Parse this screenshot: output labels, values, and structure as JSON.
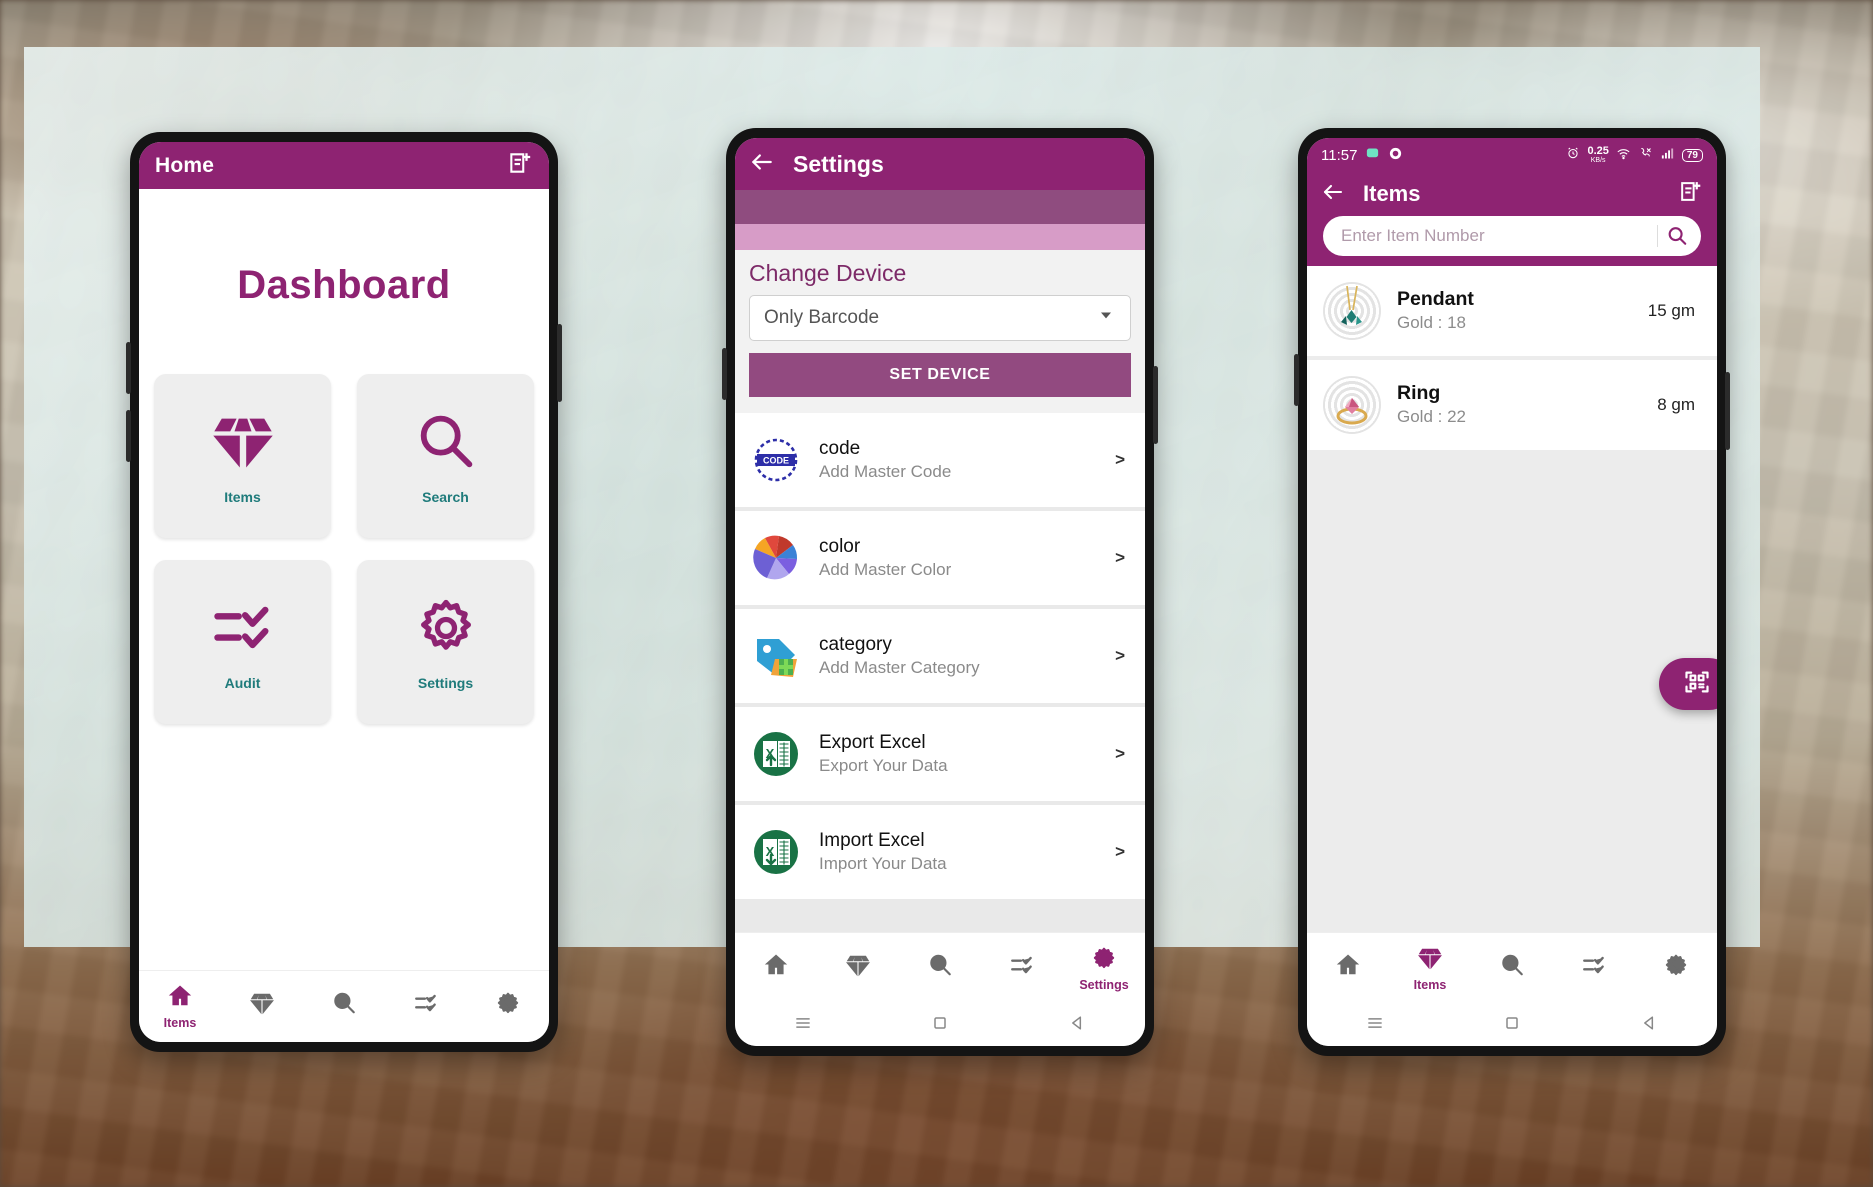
{
  "theme": {
    "brand_purple": "#8E2372",
    "tile_label_teal": "#1f7b7b",
    "muted_purple": "#8f4c7f",
    "light_pink": "#d79cc7"
  },
  "phone1": {
    "appbar": {
      "title": "Home",
      "action_icon": "note-add-icon"
    },
    "dashboard_title": "Dashboard",
    "tiles": [
      {
        "label": "Items",
        "icon": "diamond-icon"
      },
      {
        "label": "Search",
        "icon": "search-icon"
      },
      {
        "label": "Audit",
        "icon": "checklist-icon"
      },
      {
        "label": "Settings",
        "icon": "gear-icon"
      }
    ],
    "bottom_nav": [
      {
        "label": "Items",
        "icon": "home-icon",
        "active": true
      },
      {
        "label": "",
        "icon": "diamond-icon",
        "active": false
      },
      {
        "label": "",
        "icon": "search-icon",
        "active": false
      },
      {
        "label": "",
        "icon": "checklist-icon",
        "active": false
      },
      {
        "label": "",
        "icon": "gear-icon",
        "active": false
      }
    ]
  },
  "phone2": {
    "appbar": {
      "back_icon": "back-arrow-icon",
      "title": "Settings"
    },
    "section": {
      "title": "Change Device",
      "select_value": "Only Barcode",
      "select_icon": "chevron-down-icon",
      "button_label": "SET DEVICE"
    },
    "rows": [
      {
        "title": "code",
        "subtitle": "Add Master Code",
        "icon": "code-stamp-icon",
        "chevron": ">"
      },
      {
        "title": "color",
        "subtitle": "Add Master Color",
        "icon": "color-fan-icon",
        "chevron": ">"
      },
      {
        "title": "category",
        "subtitle": "Add Master Category",
        "icon": "category-tag-icon",
        "chevron": ">"
      },
      {
        "title": "Export Excel",
        "subtitle": "Export Your Data",
        "icon": "excel-export-icon",
        "chevron": ">"
      },
      {
        "title": "Import Excel",
        "subtitle": "Import Your Data",
        "icon": "excel-import-icon",
        "chevron": ">"
      }
    ],
    "bottom_nav": [
      {
        "label": "",
        "icon": "home-icon",
        "active": false
      },
      {
        "label": "",
        "icon": "diamond-icon",
        "active": false
      },
      {
        "label": "",
        "icon": "search-icon",
        "active": false
      },
      {
        "label": "",
        "icon": "checklist-icon",
        "active": false
      },
      {
        "label": "Settings",
        "icon": "gear-icon",
        "active": true
      }
    ],
    "softkeys": [
      "menu-icon",
      "home-square-icon",
      "back-triangle-icon"
    ]
  },
  "phone3": {
    "status_bar": {
      "time": "11:57",
      "left_icons": [
        "chat-bubble-icon",
        "record-circle-icon"
      ],
      "net_speed": "0.25",
      "net_speed_unit": "KB/s",
      "right_icons": [
        "alarm-icon",
        "wifi-icon",
        "call-icon",
        "signal-icon"
      ],
      "battery": "79"
    },
    "appbar": {
      "back_icon": "back-arrow-icon",
      "title": "Items",
      "action_icon": "note-add-icon"
    },
    "search": {
      "placeholder": "Enter Item Number",
      "value": "",
      "icon": "search-icon"
    },
    "items": [
      {
        "name": "Pendant",
        "detail": "Gold : 18",
        "weight": "15 gm",
        "thumb": "pendant-photo"
      },
      {
        "name": "Ring",
        "detail": "Gold : 22",
        "weight": "8 gm",
        "thumb": "ring-photo"
      }
    ],
    "fab": {
      "icon": "qr-scan-icon"
    },
    "bottom_nav": [
      {
        "label": "",
        "icon": "home-icon",
        "active": false
      },
      {
        "label": "Items",
        "icon": "diamond-icon",
        "active": true
      },
      {
        "label": "",
        "icon": "search-icon",
        "active": false
      },
      {
        "label": "",
        "icon": "checklist-icon",
        "active": false
      },
      {
        "label": "",
        "icon": "gear-icon",
        "active": false
      }
    ],
    "softkeys": [
      "menu-icon",
      "home-square-icon",
      "back-triangle-icon"
    ]
  }
}
